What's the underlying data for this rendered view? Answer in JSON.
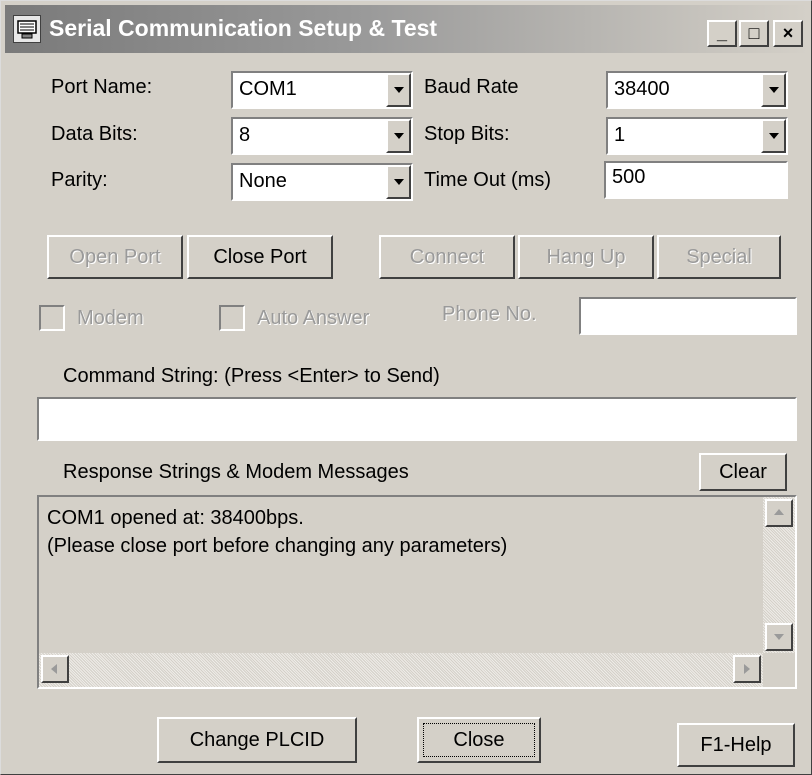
{
  "window": {
    "title": "Serial Communication Setup & Test",
    "minimize_glyph": "_",
    "maximize_glyph": "□",
    "close_glyph": "×"
  },
  "settings": {
    "port_name_label": "Port Name:",
    "port_name_value": "COM1",
    "baud_rate_label": "Baud Rate",
    "baud_rate_value": "38400",
    "data_bits_label": "Data Bits:",
    "data_bits_value": "8",
    "stop_bits_label": "Stop Bits:",
    "stop_bits_value": "1",
    "parity_label": "Parity:",
    "parity_value": "None",
    "timeout_label": "Time Out (ms)",
    "timeout_value": "500"
  },
  "buttons": {
    "open_port": "Open Port",
    "close_port": "Close Port",
    "connect": "Connect",
    "hang_up": "Hang Up",
    "special": "Special",
    "clear": "Clear",
    "change_plcid": "Change PLCID",
    "close": "Close",
    "help": "F1-Help"
  },
  "modem": {
    "modem_label": "Modem",
    "modem_checked": false,
    "auto_answer_label": "Auto Answer",
    "auto_answer_checked": false,
    "phone_label": "Phone No.",
    "phone_value": ""
  },
  "command": {
    "label": "Command String: (Press <Enter> to Send)",
    "value": ""
  },
  "response": {
    "label": "Response Strings & Modem Messages",
    "lines": [
      "COM1 opened at: 38400bps.",
      "(Please close port before changing any parameters)"
    ]
  },
  "icons": {
    "app": "app-icon",
    "dropdown": "chevron-down-icon",
    "scroll_up": "scroll-up-icon",
    "scroll_down": "scroll-down-icon",
    "scroll_left": "scroll-left-icon",
    "scroll_right": "scroll-right-icon"
  }
}
